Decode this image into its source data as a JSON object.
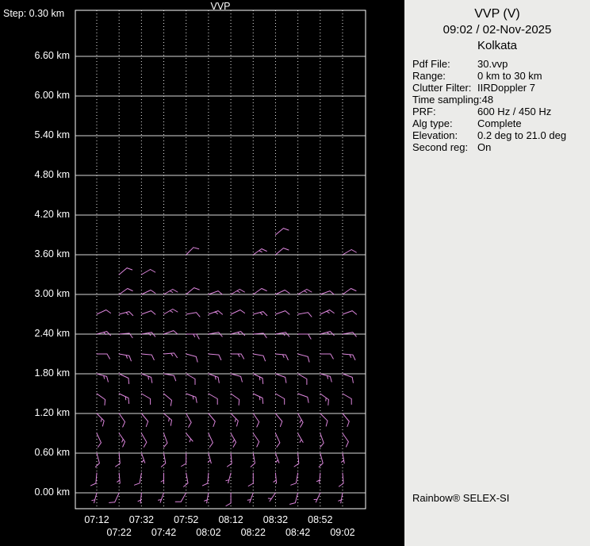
{
  "panel": {
    "title": "VVP (V)",
    "datetime": "09:02 / 02-Nov-2025",
    "location": "Kolkata",
    "info": [
      {
        "label": "Pdf File:",
        "value": "30.vvp"
      },
      {
        "label": "Range:",
        "value": "0 km to 30 km"
      },
      {
        "label": "Clutter Filter:",
        "value": "IIRDoppler 7"
      },
      {
        "label": "Time sampling:",
        "value": "48"
      },
      {
        "label": "PRF:",
        "value": "600 Hz / 450 Hz"
      },
      {
        "label": "Alg type:",
        "value": "Complete"
      },
      {
        "label": "Elevation:",
        "value": "0.2 deg to 21.0 deg"
      },
      {
        "label": "Second reg:",
        "value": "On"
      }
    ],
    "footer": "Rainbow® SELEX-SI"
  },
  "colors": {
    "background": "#000000",
    "grid_line": "#d9d9d9",
    "grid_dotted": "#ffffff",
    "plot_text": "#ffffff",
    "panel_bg": "#ebebe9",
    "panel_text": "#000000",
    "barb": "#dd86dd"
  },
  "chart_data": {
    "type": "wind-barb",
    "description": "VVP time-height wind profile; wind barbs (estimated speeds in knots, directions in degrees) plotted per 10-minute time step and 0.30 km altitude step",
    "title": "VVP",
    "step_label": "Step: 0.30 km",
    "barb_unit": "kt",
    "barb_color": "#dd86dd",
    "x_axis": {
      "times": [
        "07:12",
        "07:22",
        "07:32",
        "07:42",
        "07:52",
        "08:02",
        "08:12",
        "08:22",
        "08:32",
        "08:42",
        "08:52",
        "09:02"
      ]
    },
    "y_axis": {
      "unit": "km",
      "step_km": 0.3,
      "labels": [
        "6.60 km",
        "6.00 km",
        "5.40 km",
        "4.80 km",
        "4.20 km",
        "3.60 km",
        "3.00 km",
        "2.40 km",
        "1.80 km",
        "1.20 km",
        "0.60 km",
        "0.00 km"
      ]
    },
    "rows": [
      {
        "h": 0.0,
        "cols": [
          0,
          1,
          2,
          3,
          4,
          5,
          6,
          7,
          8,
          9,
          10,
          11
        ],
        "dir": [
          195,
          205,
          185,
          200,
          210,
          190,
          180,
          200,
          215,
          195,
          205,
          190
        ],
        "spd": [
          5,
          10,
          5,
          5,
          10,
          5,
          10,
          5,
          5,
          10,
          5,
          5
        ]
      },
      {
        "h": 0.3,
        "cols": [
          0,
          1,
          2,
          3,
          4,
          5,
          6,
          7,
          8,
          9,
          10,
          11
        ],
        "dir": [
          185,
          175,
          190,
          180,
          170,
          185,
          195,
          180,
          175,
          190,
          185,
          175
        ],
        "spd": [
          10,
          5,
          10,
          5,
          10,
          10,
          5,
          10,
          5,
          10,
          5,
          10
        ]
      },
      {
        "h": 0.6,
        "cols": [
          0,
          1,
          2,
          3,
          4,
          5,
          6,
          7,
          8,
          9,
          10,
          11
        ],
        "dir": [
          165,
          175,
          160,
          170,
          180,
          165,
          175,
          170,
          160,
          175,
          165,
          170
        ],
        "spd": [
          10,
          10,
          5,
          10,
          10,
          5,
          10,
          10,
          5,
          10,
          10,
          5
        ]
      },
      {
        "h": 0.9,
        "cols": [
          0,
          1,
          2,
          3,
          4,
          5,
          6,
          7,
          8,
          9,
          10,
          11
        ],
        "dir": [
          155,
          145,
          150,
          160,
          140,
          155,
          150,
          145,
          155,
          150,
          160,
          145
        ],
        "spd": [
          10,
          15,
          10,
          10,
          5,
          10,
          15,
          10,
          10,
          5,
          10,
          10
        ]
      },
      {
        "h": 1.2,
        "cols": [
          0,
          1,
          2,
          3,
          4,
          5,
          6,
          7,
          8,
          9,
          10,
          11
        ],
        "dir": [
          135,
          145,
          140,
          130,
          150,
          140,
          135,
          145,
          140,
          150,
          135,
          140
        ],
        "spd": [
          15,
          10,
          10,
          15,
          10,
          10,
          15,
          10,
          10,
          15,
          10,
          10
        ]
      },
      {
        "h": 1.5,
        "cols": [
          0,
          1,
          2,
          3,
          4,
          5,
          6,
          7,
          8,
          9,
          10,
          11
        ],
        "dir": [
          125,
          115,
          120,
          130,
          110,
          120,
          125,
          115,
          120,
          110,
          125,
          120
        ],
        "spd": [
          10,
          15,
          10,
          10,
          15,
          10,
          10,
          15,
          10,
          10,
          15,
          10
        ]
      },
      {
        "h": 1.8,
        "cols": [
          0,
          1,
          2,
          3,
          4,
          5,
          6,
          7,
          8,
          9,
          10,
          11
        ],
        "dir": [
          105,
          115,
          110,
          100,
          120,
          110,
          105,
          115,
          110,
          120,
          105,
          110
        ],
        "spd": [
          15,
          10,
          15,
          10,
          10,
          15,
          10,
          15,
          10,
          10,
          15,
          10
        ]
      },
      {
        "h": 2.1,
        "cols": [
          0,
          1,
          2,
          3,
          4,
          5,
          6,
          7,
          8,
          9,
          10,
          11
        ],
        "dir": [
          90,
          100,
          95,
          85,
          105,
          95,
          90,
          100,
          95,
          105,
          90,
          95
        ],
        "spd": [
          10,
          15,
          10,
          15,
          10,
          10,
          15,
          10,
          15,
          10,
          10,
          15
        ]
      },
      {
        "h": 2.4,
        "cols": [
          0,
          1,
          2,
          3,
          4,
          5,
          6,
          7,
          8,
          9,
          10,
          11
        ],
        "dir": [
          75,
          85,
          80,
          70,
          90,
          80,
          75,
          85,
          80,
          90,
          75,
          80
        ],
        "spd": [
          15,
          10,
          15,
          10,
          15,
          10,
          15,
          10,
          15,
          10,
          15,
          10
        ]
      },
      {
        "h": 2.7,
        "cols": [
          0,
          1,
          2,
          3,
          4,
          5,
          6,
          7,
          8,
          9,
          10,
          11
        ],
        "dir": [
          65,
          75,
          70,
          60,
          80,
          70,
          65,
          75,
          70,
          80,
          65,
          70
        ],
        "spd": [
          10,
          15,
          10,
          15,
          10,
          15,
          10,
          15,
          10,
          10,
          15,
          10
        ]
      },
      {
        "h": 3.0,
        "cols": [
          1,
          2,
          3,
          4,
          5,
          6,
          7,
          8,
          9,
          10,
          11
        ],
        "dir": [
          55,
          65,
          60,
          50,
          70,
          60,
          55,
          65,
          60,
          70,
          55
        ],
        "spd": [
          10,
          10,
          15,
          10,
          10,
          15,
          10,
          10,
          15,
          10,
          10
        ]
      },
      {
        "h": 3.3,
        "cols": [
          1,
          2
        ],
        "dir": [
          50,
          60
        ],
        "spd": [
          10,
          10
        ]
      },
      {
        "h": 3.6,
        "cols": [
          4,
          7,
          8,
          11
        ],
        "dir": [
          45,
          55,
          50,
          60
        ],
        "spd": [
          10,
          15,
          10,
          10
        ]
      },
      {
        "h": 3.9,
        "cols": [
          8
        ],
        "dir": [
          50
        ],
        "spd": [
          10
        ]
      }
    ]
  }
}
